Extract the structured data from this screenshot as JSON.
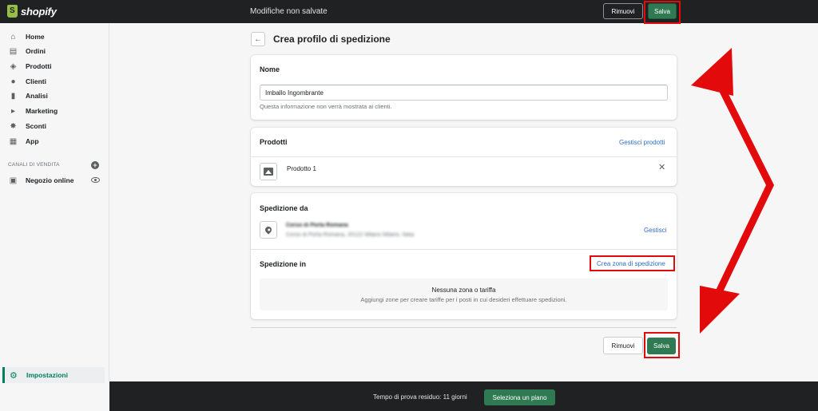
{
  "topbar": {
    "brand": "shopify",
    "title": "Modifiche non salvate",
    "remove_label": "Rimuovi",
    "save_label": "Salva"
  },
  "sidebar": {
    "items": [
      {
        "label": "Home",
        "icon": "home-icon"
      },
      {
        "label": "Ordini",
        "icon": "orders-icon"
      },
      {
        "label": "Prodotti",
        "icon": "tag-icon"
      },
      {
        "label": "Clienti",
        "icon": "person-icon"
      },
      {
        "label": "Analisi",
        "icon": "bar-chart-icon"
      },
      {
        "label": "Marketing",
        "icon": "megaphone-icon"
      },
      {
        "label": "Sconti",
        "icon": "discount-icon"
      },
      {
        "label": "App",
        "icon": "apps-icon"
      }
    ],
    "channels_title": "CANALI DI VENDITA",
    "online_store": "Negozio online",
    "settings": "Impostazioni"
  },
  "page": {
    "title": "Crea profilo di spedizione"
  },
  "name_card": {
    "title": "Nome",
    "value": "Imballo Ingombrante",
    "help": "Questa informazione non verrà mostrata ai clienti."
  },
  "products_card": {
    "title": "Prodotti",
    "manage_link": "Gestisci prodotti",
    "product_name": "Prodotto 1"
  },
  "shipping_card": {
    "from_title": "Spedizione da",
    "location_name": "Corso di Porta Romana",
    "location_address": "Corso di Porta Romana, 20122 Milano Milano, Italia",
    "manage_link": "Gestisci",
    "to_title": "Spedizione in",
    "create_zone_link": "Crea zona di spedizione",
    "empty_title": "Nessuna zona o tariffa",
    "empty_sub": "Aggiungi zone per creare tariffe per i posti in cui desideri effettuare spedizioni."
  },
  "footer": {
    "remove_label": "Rimuovi",
    "save_label": "Salva"
  },
  "trial": {
    "text": "Tempo di prova residuo: 11 giorni",
    "plan_button": "Seleziona un piano"
  },
  "colors": {
    "primary_green": "#2f7a52",
    "link_blue": "#2c6ecb",
    "annotation_red": "#e20a0a",
    "topbar_bg": "#202123"
  }
}
